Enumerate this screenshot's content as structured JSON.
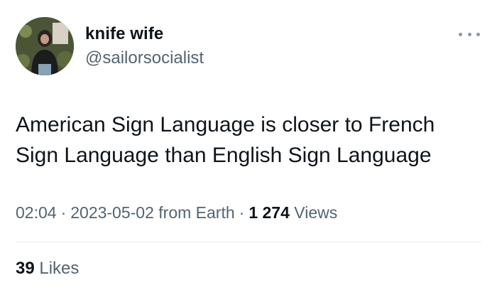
{
  "author": {
    "display_name": "knife wife",
    "handle": "@sailorsocialist",
    "avatar_icon": "profile-photo"
  },
  "more_icon": "more-options-icon",
  "tweet": {
    "text": "American Sign Language is closer to French Sign Language than English Sign Language"
  },
  "meta": {
    "time": "02:04",
    "date": "2023-05-02",
    "source": "from Earth",
    "separator": "·",
    "views_count": "1 274",
    "views_label": "Views"
  },
  "engagement": {
    "likes_count": "39",
    "likes_label": "Likes"
  },
  "colors": {
    "text_primary": "#0f1419",
    "text_secondary": "#536471",
    "divider": "#e6ecf0"
  }
}
